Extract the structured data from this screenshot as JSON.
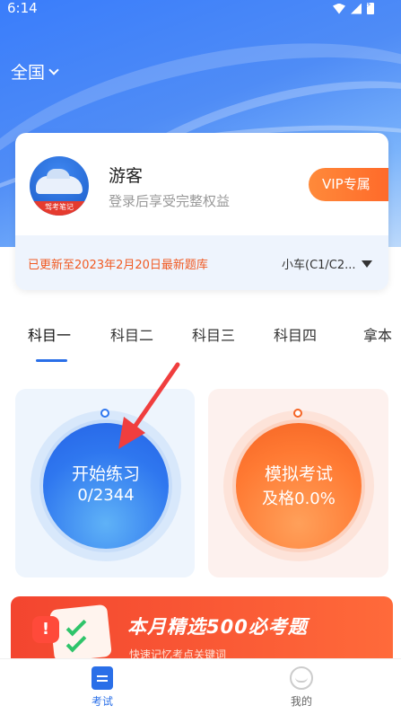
{
  "status_bar": {
    "time": "6:14"
  },
  "header": {
    "region": "全国"
  },
  "profile": {
    "name": "游客",
    "subtitle": "登录后享受完整权益",
    "vip_label": "VIP专属",
    "avatar_label": "驾考笔记",
    "update_notice": "已更新至2023年2月20日最新题库",
    "car_type": "小车(C1/C2..."
  },
  "subjects": {
    "tabs": [
      "科目一",
      "科目二",
      "科目三",
      "科目四",
      "拿本"
    ],
    "active_index": 0
  },
  "practice": {
    "title": "开始练习",
    "progress": "0/2344",
    "done": 0,
    "total": 2344
  },
  "mock_exam": {
    "title": "模拟考试",
    "pass_rate": "及格0.0%"
  },
  "banner": {
    "title": "本月精选500必考题",
    "subtitle": "快速记忆考点关键词"
  },
  "bottom_nav": {
    "items": [
      {
        "label": "考试",
        "icon": "exam-icon"
      },
      {
        "label": "我的",
        "icon": "profile-icon"
      }
    ]
  },
  "colors": {
    "primary": "#2a6fe8",
    "accent": "#ff6a2a",
    "notice": "#f05a23"
  }
}
